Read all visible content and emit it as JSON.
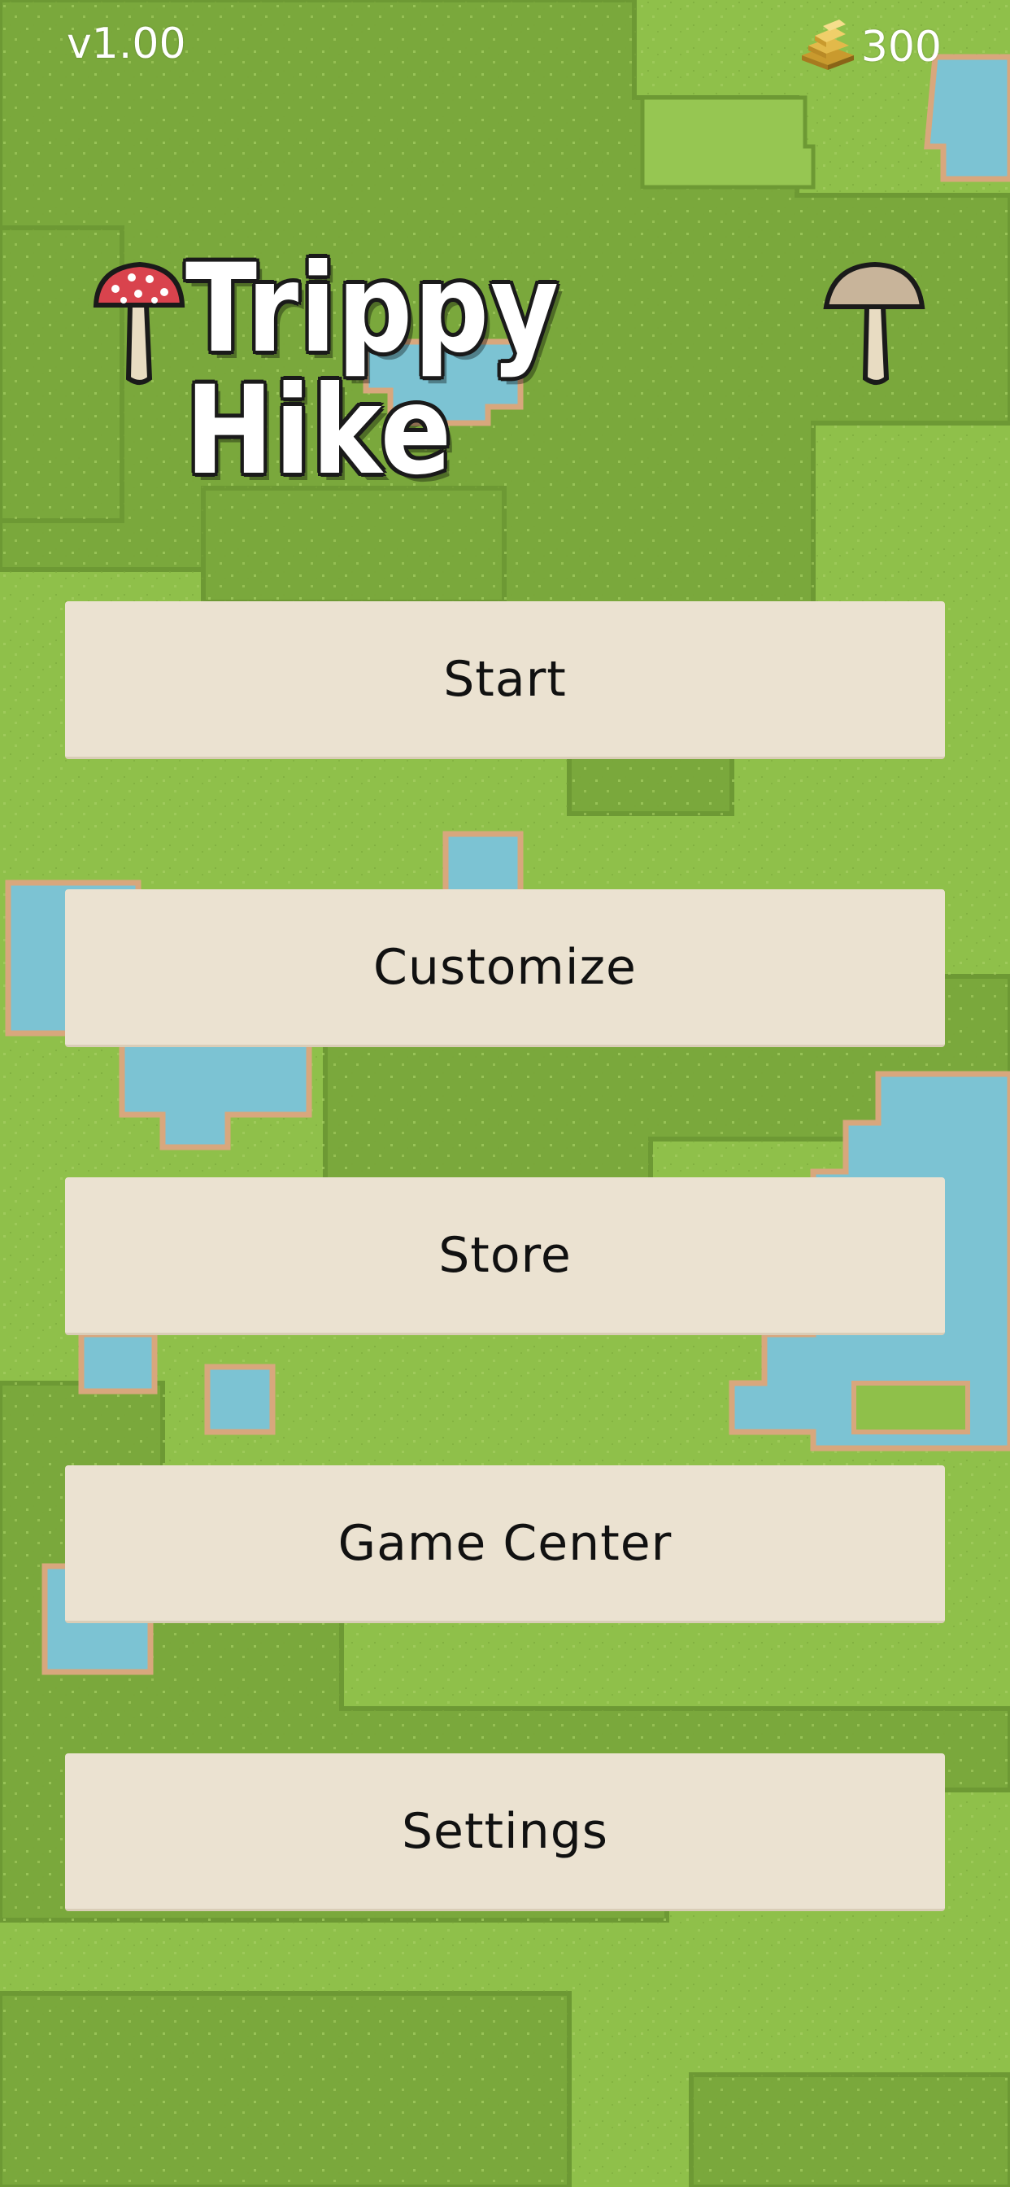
{
  "hud": {
    "version": "v1.00",
    "coins": "300",
    "coin_icon": "gold-bars-icon"
  },
  "title": {
    "text": "Trippy Hike",
    "left_icon": "red-mushroom-icon",
    "right_icon": "tan-mushroom-icon"
  },
  "menu": {
    "start": "Start",
    "customize": "Customize",
    "store": "Store",
    "game_center": "Game Center",
    "settings": "Settings"
  },
  "colors": {
    "grass_light": "#8fc04a",
    "grass_dark": "#7fae3f",
    "water": "#7cc3d3",
    "shore": "#d8a77d",
    "button_bg": "#ebe2d1",
    "button_text": "#111111"
  }
}
